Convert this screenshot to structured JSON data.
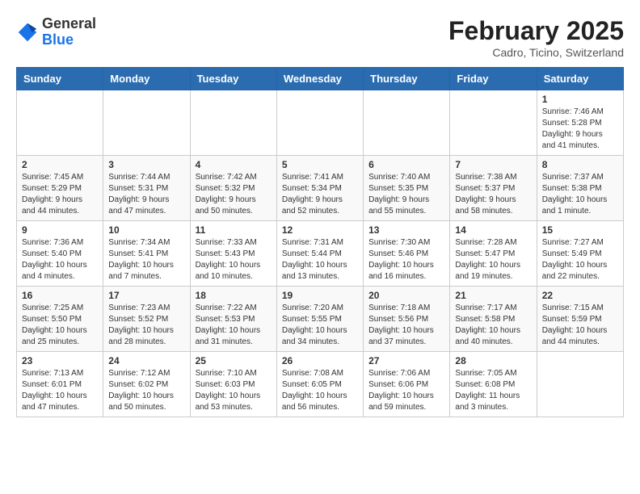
{
  "header": {
    "logo_line1": "General",
    "logo_line2": "Blue",
    "month_year": "February 2025",
    "location": "Cadro, Ticino, Switzerland"
  },
  "weekdays": [
    "Sunday",
    "Monday",
    "Tuesday",
    "Wednesday",
    "Thursday",
    "Friday",
    "Saturday"
  ],
  "weeks": [
    [
      {
        "day": null,
        "info": null
      },
      {
        "day": null,
        "info": null
      },
      {
        "day": null,
        "info": null
      },
      {
        "day": null,
        "info": null
      },
      {
        "day": null,
        "info": null
      },
      {
        "day": null,
        "info": null
      },
      {
        "day": "1",
        "info": "Sunrise: 7:46 AM\nSunset: 5:28 PM\nDaylight: 9 hours and 41 minutes."
      }
    ],
    [
      {
        "day": "2",
        "info": "Sunrise: 7:45 AM\nSunset: 5:29 PM\nDaylight: 9 hours and 44 minutes."
      },
      {
        "day": "3",
        "info": "Sunrise: 7:44 AM\nSunset: 5:31 PM\nDaylight: 9 hours and 47 minutes."
      },
      {
        "day": "4",
        "info": "Sunrise: 7:42 AM\nSunset: 5:32 PM\nDaylight: 9 hours and 50 minutes."
      },
      {
        "day": "5",
        "info": "Sunrise: 7:41 AM\nSunset: 5:34 PM\nDaylight: 9 hours and 52 minutes."
      },
      {
        "day": "6",
        "info": "Sunrise: 7:40 AM\nSunset: 5:35 PM\nDaylight: 9 hours and 55 minutes."
      },
      {
        "day": "7",
        "info": "Sunrise: 7:38 AM\nSunset: 5:37 PM\nDaylight: 9 hours and 58 minutes."
      },
      {
        "day": "8",
        "info": "Sunrise: 7:37 AM\nSunset: 5:38 PM\nDaylight: 10 hours and 1 minute."
      }
    ],
    [
      {
        "day": "9",
        "info": "Sunrise: 7:36 AM\nSunset: 5:40 PM\nDaylight: 10 hours and 4 minutes."
      },
      {
        "day": "10",
        "info": "Sunrise: 7:34 AM\nSunset: 5:41 PM\nDaylight: 10 hours and 7 minutes."
      },
      {
        "day": "11",
        "info": "Sunrise: 7:33 AM\nSunset: 5:43 PM\nDaylight: 10 hours and 10 minutes."
      },
      {
        "day": "12",
        "info": "Sunrise: 7:31 AM\nSunset: 5:44 PM\nDaylight: 10 hours and 13 minutes."
      },
      {
        "day": "13",
        "info": "Sunrise: 7:30 AM\nSunset: 5:46 PM\nDaylight: 10 hours and 16 minutes."
      },
      {
        "day": "14",
        "info": "Sunrise: 7:28 AM\nSunset: 5:47 PM\nDaylight: 10 hours and 19 minutes."
      },
      {
        "day": "15",
        "info": "Sunrise: 7:27 AM\nSunset: 5:49 PM\nDaylight: 10 hours and 22 minutes."
      }
    ],
    [
      {
        "day": "16",
        "info": "Sunrise: 7:25 AM\nSunset: 5:50 PM\nDaylight: 10 hours and 25 minutes."
      },
      {
        "day": "17",
        "info": "Sunrise: 7:23 AM\nSunset: 5:52 PM\nDaylight: 10 hours and 28 minutes."
      },
      {
        "day": "18",
        "info": "Sunrise: 7:22 AM\nSunset: 5:53 PM\nDaylight: 10 hours and 31 minutes."
      },
      {
        "day": "19",
        "info": "Sunrise: 7:20 AM\nSunset: 5:55 PM\nDaylight: 10 hours and 34 minutes."
      },
      {
        "day": "20",
        "info": "Sunrise: 7:18 AM\nSunset: 5:56 PM\nDaylight: 10 hours and 37 minutes."
      },
      {
        "day": "21",
        "info": "Sunrise: 7:17 AM\nSunset: 5:58 PM\nDaylight: 10 hours and 40 minutes."
      },
      {
        "day": "22",
        "info": "Sunrise: 7:15 AM\nSunset: 5:59 PM\nDaylight: 10 hours and 44 minutes."
      }
    ],
    [
      {
        "day": "23",
        "info": "Sunrise: 7:13 AM\nSunset: 6:01 PM\nDaylight: 10 hours and 47 minutes."
      },
      {
        "day": "24",
        "info": "Sunrise: 7:12 AM\nSunset: 6:02 PM\nDaylight: 10 hours and 50 minutes."
      },
      {
        "day": "25",
        "info": "Sunrise: 7:10 AM\nSunset: 6:03 PM\nDaylight: 10 hours and 53 minutes."
      },
      {
        "day": "26",
        "info": "Sunrise: 7:08 AM\nSunset: 6:05 PM\nDaylight: 10 hours and 56 minutes."
      },
      {
        "day": "27",
        "info": "Sunrise: 7:06 AM\nSunset: 6:06 PM\nDaylight: 10 hours and 59 minutes."
      },
      {
        "day": "28",
        "info": "Sunrise: 7:05 AM\nSunset: 6:08 PM\nDaylight: 11 hours and 3 minutes."
      },
      {
        "day": null,
        "info": null
      }
    ]
  ]
}
